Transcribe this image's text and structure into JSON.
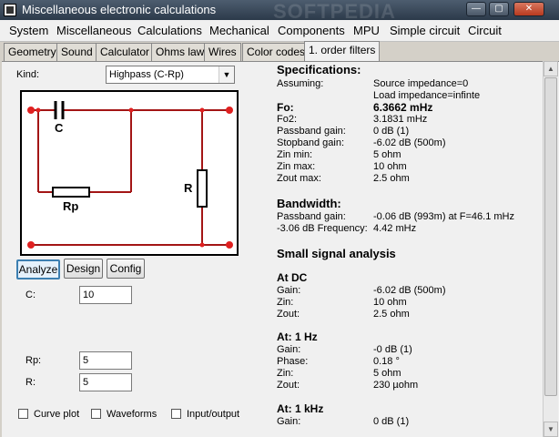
{
  "window": {
    "title": "Miscellaneous electronic calculations",
    "watermark": "SOFTPEDIA",
    "controls": [
      "—",
      "▢",
      "✕"
    ]
  },
  "menu": [
    "System",
    "Miscellaneous",
    "Calculations",
    "Mechanical",
    "Components",
    "MPU",
    "Simple circuit",
    "Circuit"
  ],
  "tabs": [
    "Geometry",
    "Sound",
    "Calculator",
    "Ohms law",
    "Wires",
    "Color codes",
    "1. order filters"
  ],
  "active_tab": "1. order filters",
  "kind": {
    "label": "Kind:",
    "value": "Highpass (C-Rp)"
  },
  "circuit": {
    "labels": {
      "c": "C",
      "rp": "Rp",
      "r": "R"
    },
    "wire_color": "#a31515",
    "node_color": "#e02020"
  },
  "buttons": [
    "Analyze",
    "Design",
    "Config"
  ],
  "inputs": {
    "c": {
      "label": "C:",
      "value": "10"
    },
    "rp": {
      "label": "Rp:",
      "value": "5"
    },
    "r": {
      "label": "R:",
      "value": "5"
    }
  },
  "checkboxes": [
    "Curve plot",
    "Waveforms",
    "Input/output"
  ],
  "specs": {
    "title": "Specifications:",
    "assuming_label": "Assuming:",
    "assuming": [
      "Source impedance=0",
      "Load impedance=infinte"
    ],
    "rows": [
      {
        "k": "Fo:",
        "v": "6.3662 mHz"
      },
      {
        "k": "Fo2:",
        "v": "3.1831 mHz"
      },
      {
        "k": "Passband gain:",
        "v": "0 dB   (1)"
      },
      {
        "k": "Stopband gain:",
        "v": "-6.02 dB   (500m)"
      },
      {
        "k": "Zin min:",
        "v": "5 ohm"
      },
      {
        "k": "Zin max:",
        "v": "10 ohm"
      },
      {
        "k": "Zout max:",
        "v": "2.5 ohm"
      }
    ],
    "bandwidth_title": "Bandwidth:",
    "bandwidth": [
      {
        "k": "Passband gain:",
        "v": "-0.06 dB   (993m) at F=46.1 mHz"
      },
      {
        "k": "-3.06 dB Frequency:",
        "v": "4.42 mHz"
      }
    ],
    "small_signal_title": "Small signal analysis",
    "at_dc": {
      "title": "At DC",
      "rows": [
        {
          "k": "Gain:",
          "v": "-6.02 dB   (500m)"
        },
        {
          "k": "Zin:",
          "v": "10 ohm"
        },
        {
          "k": "Zout:",
          "v": "2.5 ohm"
        }
      ]
    },
    "at_1hz": {
      "title": "At: 1 Hz",
      "rows": [
        {
          "k": "Gain:",
          "v": "-0 dB   (1)"
        },
        {
          "k": "Phase:",
          "v": "0.18 °"
        },
        {
          "k": "Zin:",
          "v": "5 ohm"
        },
        {
          "k": "Zout:",
          "v": "230 µohm"
        }
      ]
    },
    "at_1khz": {
      "title": "At: 1 kHz",
      "rows": [
        {
          "k": "Gain:",
          "v": "0 dB   (1)"
        }
      ]
    }
  }
}
